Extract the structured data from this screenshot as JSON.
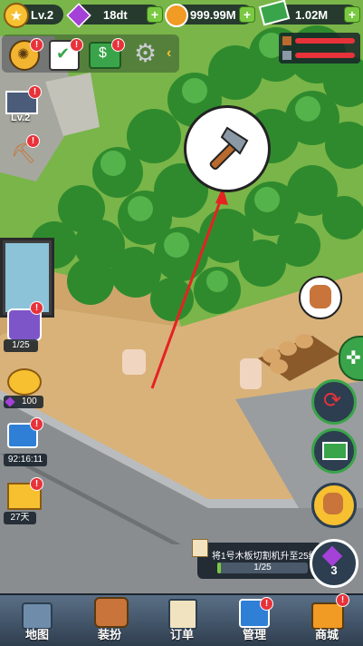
{
  "hud": {
    "level_label": "Lv.2",
    "gems_value": "18dt",
    "coins_value": "999.99M",
    "cash_value": "1.02M"
  },
  "toolbar": {
    "badge": "!"
  },
  "factory": {
    "level_label": "Lv.2"
  },
  "side": {
    "collection_count": "1/25",
    "piggy_gems": "100",
    "ad_timer": "92:16:11",
    "days_label": "27天"
  },
  "task": {
    "text": "将1号木板切割机升至25级",
    "progress_text": "1/25",
    "progress_fraction": 0.04,
    "reward_gems": "3"
  },
  "nav": {
    "map": "地图",
    "dress": "装扮",
    "orders": "订单",
    "manage": "管理",
    "shop": "商城"
  },
  "colors": {
    "grass": "#6fae3f",
    "dirt": "#d9b27a",
    "road": "#8a8d90",
    "accent_green": "#7ac943",
    "alert_red": "#e8323a",
    "gem_purple": "#a441d6",
    "coin_orange": "#f19a24"
  }
}
